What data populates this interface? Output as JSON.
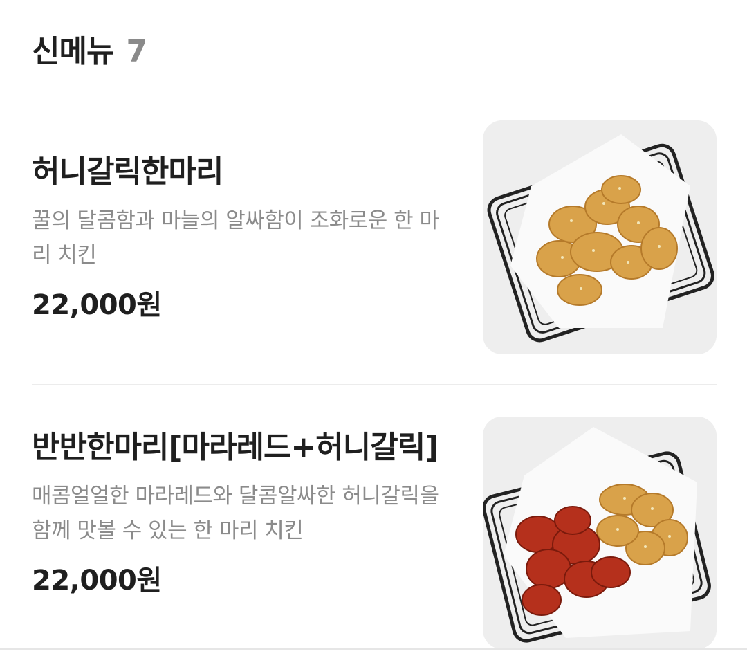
{
  "section": {
    "title": "신메뉴",
    "count": "7"
  },
  "items": [
    {
      "name": "허니갈릭한마리",
      "description": "꿀의 달콤함과 마늘의 알싸함이 조화로운 한 마리 치킨",
      "price": "22,000원",
      "image_icon": "honey-garlic-chicken-photo"
    },
    {
      "name": "반반한마리[마라레드+허니갈릭]",
      "description": "매콤얼얼한 마라레드와 달콤알싸한 허니갈릭을 함께 맛볼 수 있는 한 마리 치킨",
      "price": "22,000원",
      "image_icon": "half-half-chicken-photo"
    }
  ],
  "colors": {
    "title": "#1f1f1f",
    "count": "#8a8a8a",
    "description": "#8b8b8b",
    "thumb_bg": "#eeeeee",
    "honey_chicken": "#d9a24a",
    "mala_red_chicken": "#b5301c"
  }
}
